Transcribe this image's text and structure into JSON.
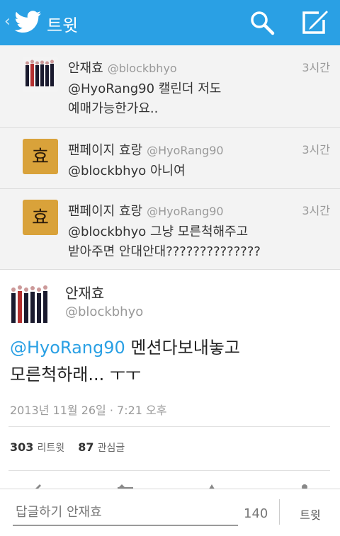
{
  "header": {
    "title": "트윗"
  },
  "replies": [
    {
      "name": "안재효",
      "handle": "@blockbhyo",
      "time": "3시간",
      "text_lines": [
        "@HyoRang90 캘린더 저도",
        "예매가능한가요.."
      ]
    },
    {
      "name": "팬페이지 효랑",
      "handle": "@HyoRang90",
      "time": "3시간",
      "text_lines": [
        "@blockbhyo 아니여"
      ]
    },
    {
      "name": "팬페이지 효랑",
      "handle": "@HyoRang90",
      "time": "3시간",
      "text_lines": [
        "@blockbhyo 그냥 모른척해주고",
        "받아주면 안대안대??????????????"
      ]
    }
  ],
  "main_tweet": {
    "name": "안재효",
    "handle": "@blockbhyo",
    "mention": "@HyoRang90",
    "text_line1_rest": " 멘션다보내놓고",
    "text_line2": "모른척하래... ㅜㅜ",
    "date": "2013년 11월 26일 · 7:21 오후",
    "retweet_count": "303",
    "retweet_label": "리트윗",
    "favorite_count": "87",
    "favorite_label": "관심글"
  },
  "composer": {
    "placeholder": "답글하기 안재효",
    "char_count": "140",
    "send_label": "트윗"
  },
  "colors": {
    "brand": "#2aa0e4",
    "thread_bg": "#f3f3f3"
  },
  "icons": [
    "back-chevron-icon",
    "twitter-bird-icon",
    "search-icon",
    "compose-icon",
    "reply-icon",
    "retweet-icon",
    "favorite-icon",
    "share-icon"
  ]
}
